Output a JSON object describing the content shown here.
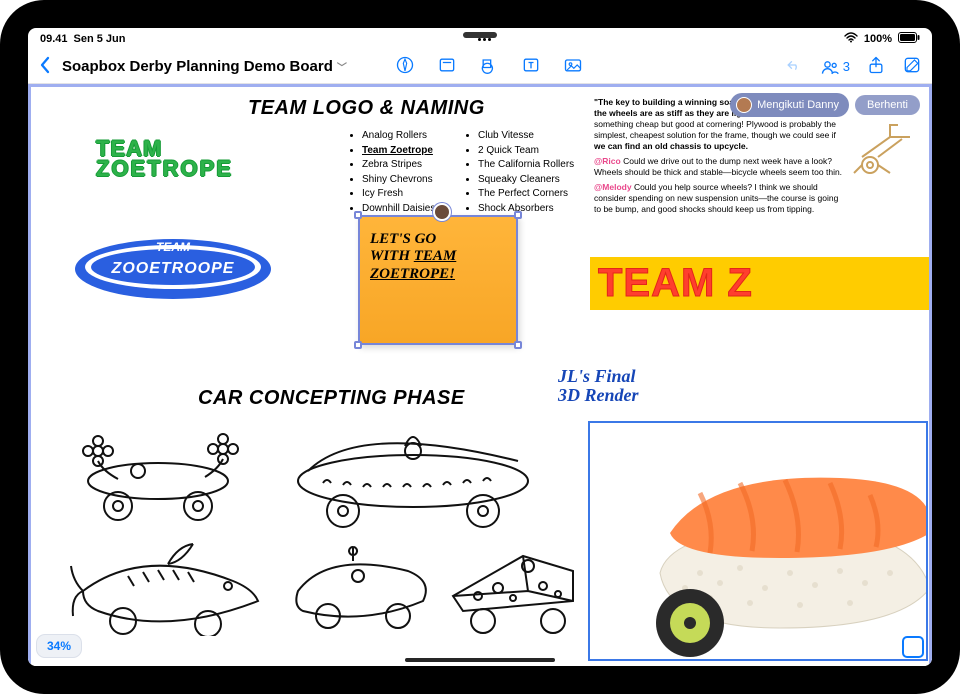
{
  "statusbar": {
    "time": "09.41",
    "date": "Sen 5 Jun",
    "battery": "100%"
  },
  "toolbar": {
    "board_title": "Soapbox Derby Planning Demo Board",
    "collab_count": "3"
  },
  "follow": {
    "following_label": "Mengikuti Danny",
    "stop_label": "Berhenti"
  },
  "headings": {
    "logo": "TEAM LOGO & NAMING",
    "car": "CAR CONCEPTING PHASE"
  },
  "logos": {
    "logo1_line1": "TEAM",
    "logo1_line2": "ZOETROPE",
    "ring_top": "TEAM",
    "ring_bottom": "ZOOETROOPE",
    "wordmark": "TEAM Z"
  },
  "names": {
    "col1": [
      "Analog Rollers",
      "Team Zoetrope",
      "Zebra Stripes",
      "Shiny Chevrons",
      "Icy Fresh",
      "Downhill Daisies"
    ],
    "col2": [
      "Club Vitesse",
      "2 Quick Team",
      "The California Rollers",
      "Squeaky Cleaners",
      "The Perfect Corners",
      "Shock Absorbers"
    ]
  },
  "sticky": {
    "line1": "LET'S GO",
    "line2": "WITH ",
    "line2u": "TEAM",
    "line3u": "ZOETROPE!"
  },
  "note": {
    "p1a": "\"The key to building a winning soapbox car is to make sure the wheels are as stiff as they are light.\"",
    "p1b": " So we need something cheap but good at cornering! Plywood is probably the simplest, cheapest solution for the frame, though we could see if ",
    "p1c": "we can find an old chassis to upcycle.",
    "m1": "@Rico",
    "p2": " Could we drive out to the dump next week have a look? Wheels should be thick and stable—bicycle wheels seem too thin.",
    "m2": "@Melody",
    "p3": " Could you help source wheels? I think we should consider spending on new suspension units—the course is going to be bump, and good shocks should keep us from tipping."
  },
  "render_label": {
    "l1": "JL's Final",
    "l2": "3D Render"
  },
  "zoom": "34%"
}
